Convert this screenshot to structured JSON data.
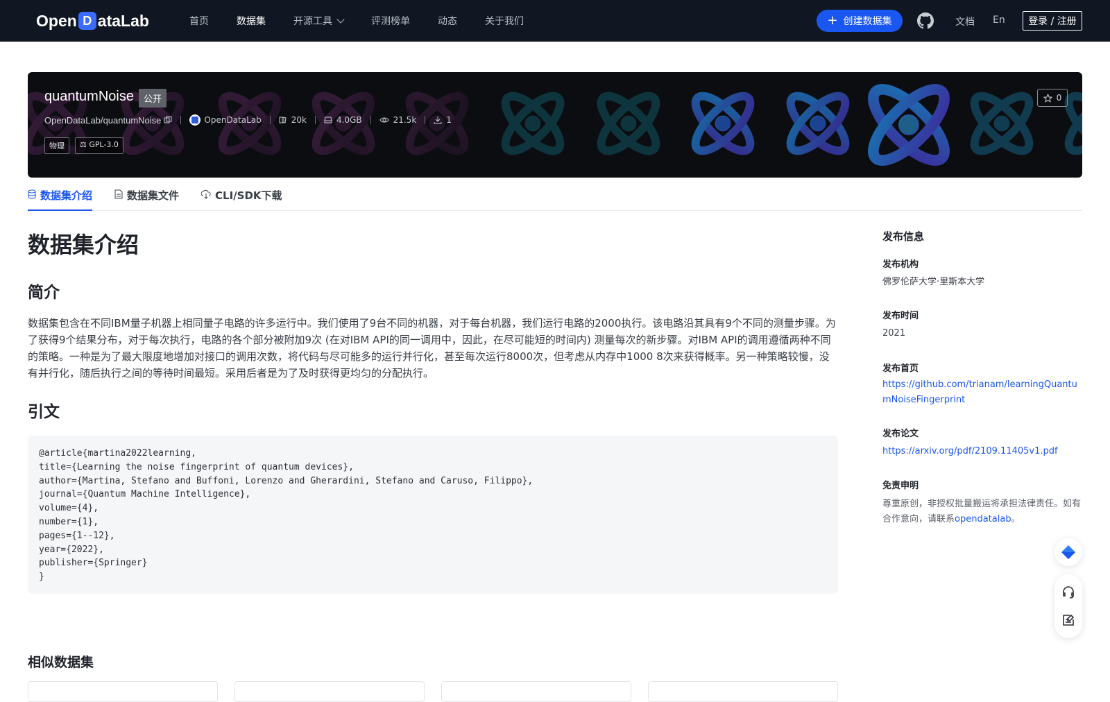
{
  "nav": {
    "logo_pre": "Open",
    "logo_d": "D",
    "logo_post": "ataLab",
    "items": [
      {
        "label": "首页",
        "active": false
      },
      {
        "label": "数据集",
        "active": true
      },
      {
        "label": "开源工具",
        "active": false,
        "dropdown": true
      },
      {
        "label": "评测榜单",
        "active": false
      },
      {
        "label": "动态",
        "active": false
      },
      {
        "label": "关于我们",
        "active": false
      }
    ],
    "create_label": "创建数据集",
    "docs_label": "文档",
    "lang_label": "En",
    "login_label": "登录 / 注册"
  },
  "dataset": {
    "name": "quantumNoise",
    "visibility": "公开",
    "path": "OpenDataLab/quantumNoise",
    "org": "OpenDataLab",
    "files_count": "20k",
    "size": "4.0GB",
    "views": "21.5k",
    "downloads": "1",
    "stars": "0",
    "tags": [
      "物理"
    ],
    "license": "GPL-3.0"
  },
  "tabs": [
    {
      "label": "数据集介绍",
      "active": true,
      "icon": "database-icon"
    },
    {
      "label": "数据集文件",
      "active": false,
      "icon": "file-icon"
    },
    {
      "label": "CLI/SDK下载",
      "active": false,
      "icon": "cloud-download-icon"
    }
  ],
  "content": {
    "heading": "数据集介绍",
    "intro_heading": "简介",
    "intro_text": "数据集包含在不同IBM量子机器上相同量子电路的许多运行中。我们使用了9台不同的机器，对于每台机器，我们运行电路的2000执行。该电路沿其具有9个不同的测量步骤。为了获得9个结果分布，对于每次执行，电路的各个部分被附加9次 (在对IBM API的同一调用中，因此，在尽可能短的时间内) 测量每次的新步骤。对IBM API的调用遵循两种不同的策略。一种是为了最大限度地增加对接口的调用次数，将代码与尽可能多的运行并行化，甚至每次运行8000次，但考虑从内存中1000 8次来获得概率。另一种策略较慢，没有并行化，随后执行之间的等待时间最短。采用后者是为了及时获得更均匀的分配执行。",
    "citation_heading": "引文",
    "citation": "@article{martina2022learning,\ntitle={Learning the noise fingerprint of quantum devices},\nauthor={Martina, Stefano and Buffoni, Lorenzo and Gherardini, Stefano and Caruso, Filippo},\njournal={Quantum Machine Intelligence},\nvolume={4},\nnumber={1},\npages={1--12},\nyear={2022},\npublisher={Springer}\n}",
    "similar_heading": "相似数据集"
  },
  "sidebar": {
    "title": "发布信息",
    "org_label": "发布机构",
    "org_value": "佛罗伦萨大学·里斯本大学",
    "time_label": "发布时间",
    "time_value": "2021",
    "home_label": "发布首页",
    "home_value": "https://github.com/trianam/learningQuantumNoiseFingerprint",
    "paper_label": "发布论文",
    "paper_value": "https://arxiv.org/pdf/2109.11405v1.pdf",
    "disclaimer_label": "免责申明",
    "disclaimer_text": "尊重原创，非授权批量搬运将承担法律责任。如有合作意向，请联系",
    "disclaimer_link": "opendatalab",
    "disclaimer_end": "。"
  },
  "colors": {
    "nav_bg": "#111722",
    "accent": "#1a56f0",
    "banner_bg": "#0c0d10"
  }
}
